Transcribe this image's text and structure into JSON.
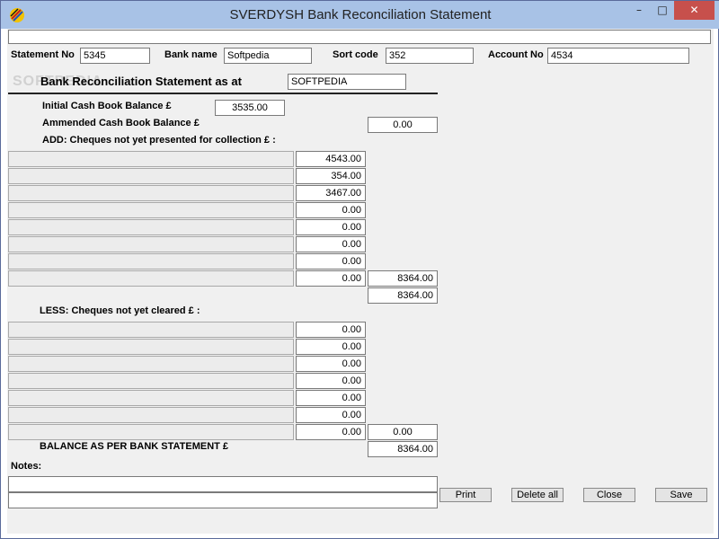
{
  "window": {
    "title": "SVERDYSH Bank Reconciliation Statement",
    "min_glyph": "–",
    "max_glyph": "□",
    "close_glyph": "✕"
  },
  "header": {
    "statement_no_label": "Statement No",
    "statement_no": "5345",
    "bank_name_label": "Bank name",
    "bank_name": "Softpedia",
    "sort_code_label": "Sort code",
    "sort_code": "352",
    "account_no_label": "Account No",
    "account_no": "4534"
  },
  "heading": {
    "label": "Bank Reconciliation Statement as at",
    "date_value": "SOFTPEDIA",
    "watermark": "SOFTPEDIA"
  },
  "balances": {
    "initial_label": "Initial Cash Book Balance £",
    "initial_value": "3535.00",
    "amended_label": "Ammended Cash Book Balance £",
    "amended_value": "0.00"
  },
  "add": {
    "label": "ADD:  Cheques not yet presented for collection £ :",
    "rows": [
      {
        "desc": "",
        "amount": "4543.00"
      },
      {
        "desc": "",
        "amount": "354.00"
      },
      {
        "desc": "",
        "amount": "3467.00"
      },
      {
        "desc": "",
        "amount": "0.00"
      },
      {
        "desc": "",
        "amount": "0.00"
      },
      {
        "desc": "",
        "amount": "0.00"
      },
      {
        "desc": "",
        "amount": "0.00"
      },
      {
        "desc": "",
        "amount": "0.00"
      }
    ],
    "subtotal": "8364.00",
    "running_total": "8364.00"
  },
  "less": {
    "label": "LESS:  Cheques not yet cleared £ :",
    "rows": [
      {
        "desc": "",
        "amount": "0.00"
      },
      {
        "desc": "",
        "amount": "0.00"
      },
      {
        "desc": "",
        "amount": "0.00"
      },
      {
        "desc": "",
        "amount": "0.00"
      },
      {
        "desc": "",
        "amount": "0.00"
      },
      {
        "desc": "",
        "amount": "0.00"
      },
      {
        "desc": "",
        "amount": "0.00"
      }
    ],
    "subtotal": "0.00"
  },
  "bank_balance": {
    "label": "BALANCE AS PER BANK STATEMENT £",
    "value": "8364.00"
  },
  "notes": {
    "label": "Notes:",
    "line1": "",
    "line2": ""
  },
  "top_bar_value": "",
  "buttons": {
    "print": "Print",
    "delete_all": "Delete all",
    "close": "Close",
    "save": "Save"
  }
}
